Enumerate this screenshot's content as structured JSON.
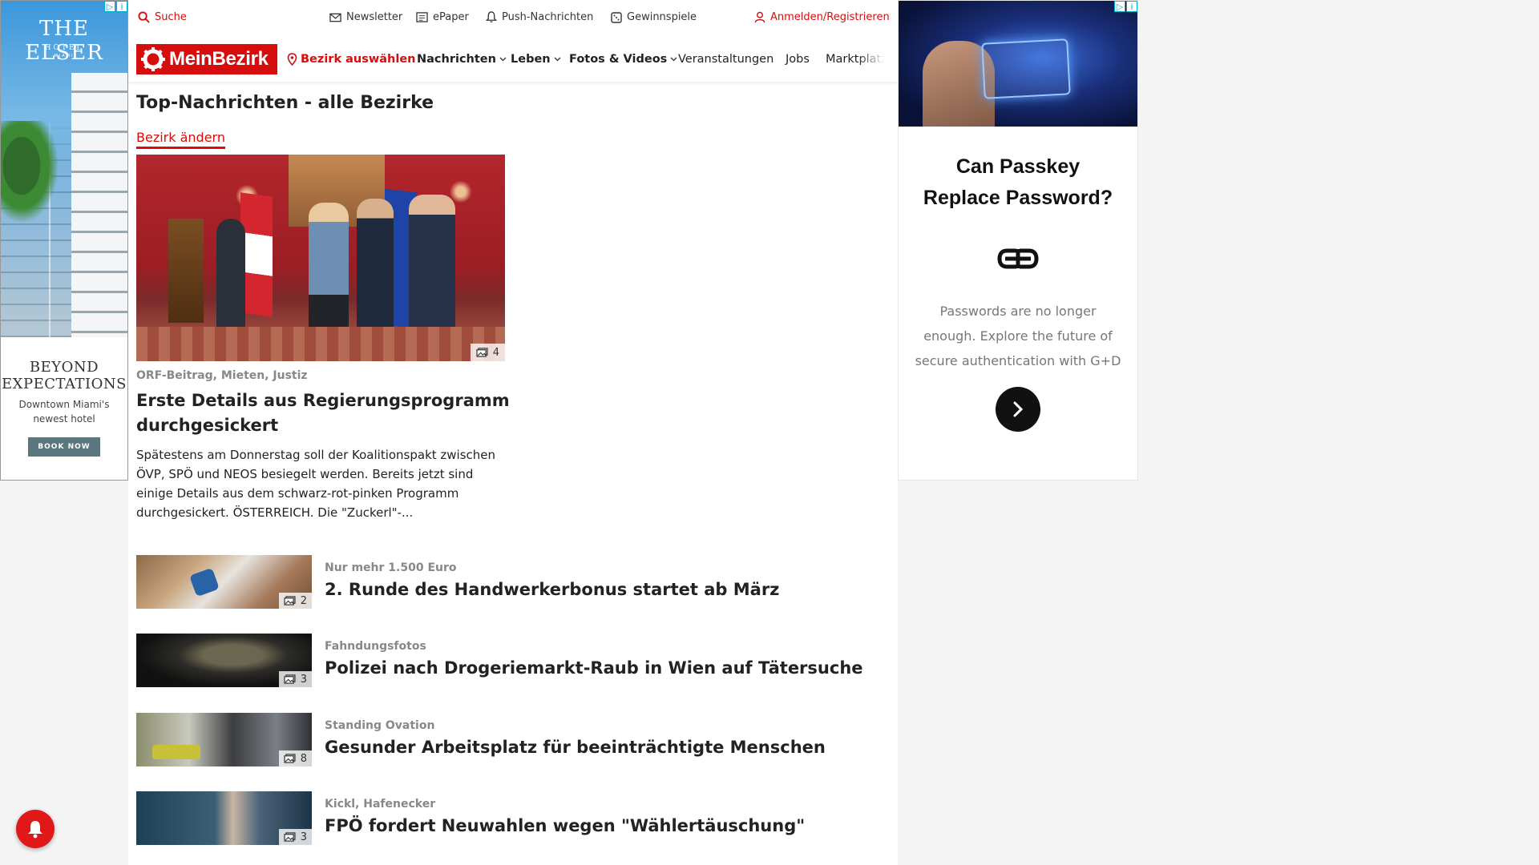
{
  "ad_left": {
    "brand": "THE ELSER",
    "brand_sub": "HOTEL",
    "brand_location": "MIAMI",
    "headline": "BEYOND EXPECTATIONS",
    "copy": "Downtown Miami's newest hotel",
    "cta": "BOOK NOW"
  },
  "topbar": {
    "search": "Suche",
    "newsletter": "Newsletter",
    "epaper": "ePaper",
    "push": "Push-Nachrichten",
    "games": "Gewinnspiele",
    "login": "Anmelden/Registrieren"
  },
  "nav": {
    "logo": "MeinBezirk",
    "district": "Bezirk auswählen",
    "items": [
      "Nachrichten",
      "Leben",
      "Fotos & Videos",
      "Veranstaltungen",
      "Jobs",
      "Marktplatz"
    ]
  },
  "page": {
    "title": "Top-Nachrichten - alle Bezirke",
    "change_district": "Bezirk ändern"
  },
  "hero": {
    "image_count": "4",
    "kicker": "ORF-Beitrag, Mieten, Justiz",
    "title": "Erste Details aus Regierungsprogramm durchgesickert",
    "teaser": "Spätestens am Donnerstag soll der Koalitionspakt zwischen ÖVP, SPÖ und NEOS besiegelt werden. Bereits jetzt sind einige Details aus dem schwarz-rot-pinken Programm durchgesickert.  ÖSTERREICH. Die \"Zuckerl\"-..."
  },
  "articles": [
    {
      "kicker": "Nur mehr 1.500 Euro",
      "title": "2. Runde des Handwerkerbonus startet ab März",
      "image_count": "2"
    },
    {
      "kicker": "Fahndungsfotos",
      "title": "Polizei nach Drogeriemarkt-Raub in Wien auf Tätersuche",
      "image_count": "3"
    },
    {
      "kicker": "Standing Ovation",
      "title": "Gesunder Arbeitsplatz für beeinträchtigte Menschen",
      "image_count": "8"
    },
    {
      "kicker": "Kickl, Hafenecker",
      "title": "FPÖ fordert Neuwahlen wegen \"Wählertäuschung\"",
      "image_count": "3"
    }
  ],
  "ad_right": {
    "headline_line1": "Can Passkey",
    "headline_line2": "Replace Password?",
    "copy": "Passwords are no longer enough. Explore the future of secure authentication with G+D"
  },
  "colors": {
    "brand_red": "#d60d0d",
    "kicker_gray": "#888888"
  },
  "icons": [
    "search-icon",
    "mail-icon",
    "newspaper-icon",
    "bell-icon",
    "dice-icon",
    "user-icon",
    "location-pin-icon",
    "chevron-down-icon",
    "image-gallery-icon",
    "arrow-right-icon"
  ]
}
